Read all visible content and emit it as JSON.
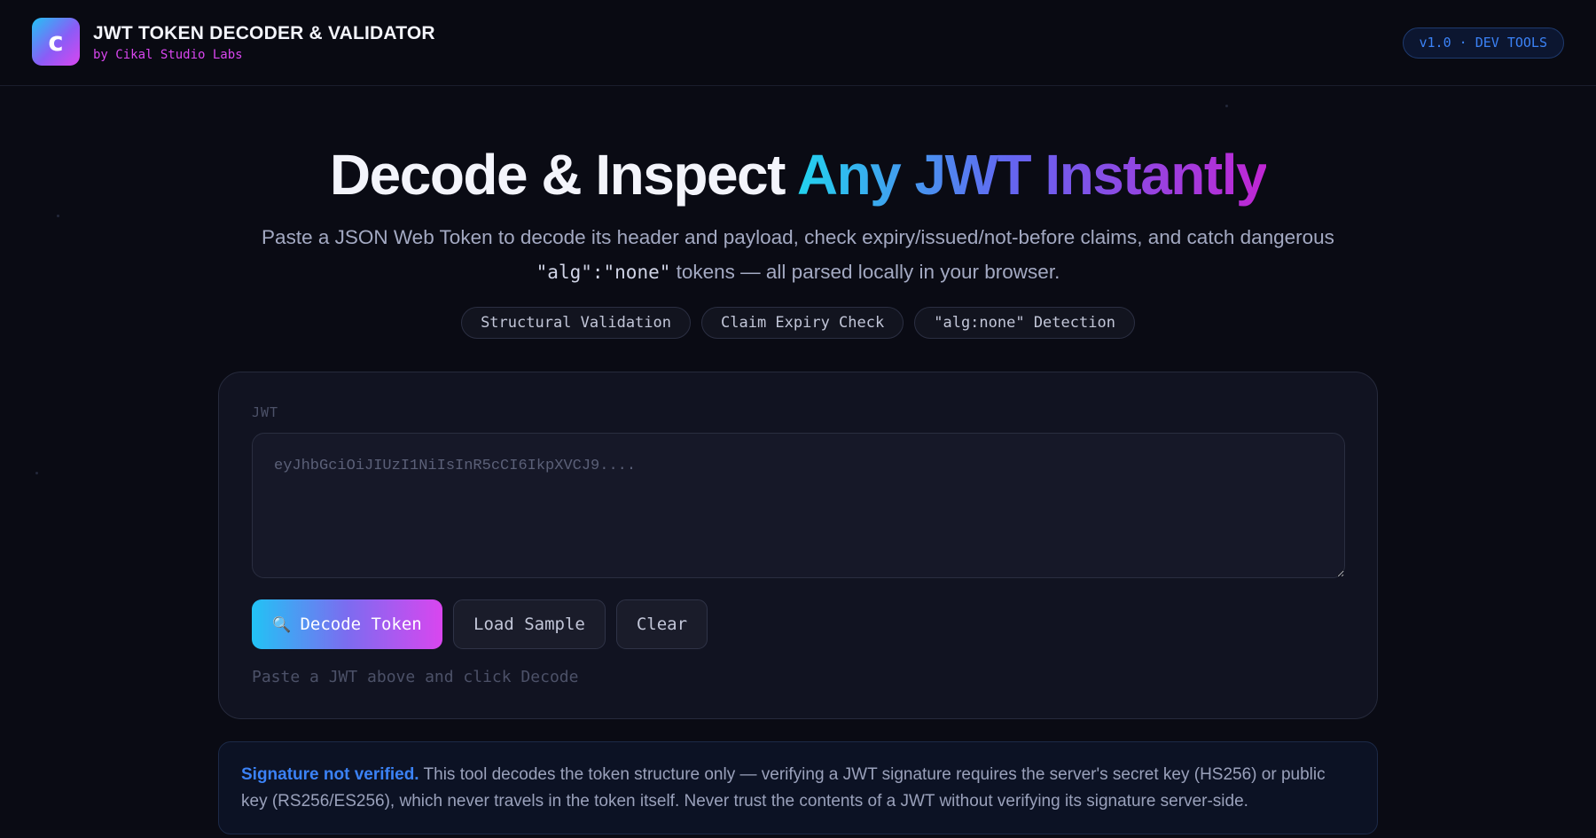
{
  "header": {
    "logo_letter": "c",
    "title": "JWT TOKEN DECODER & VALIDATOR",
    "subtitle": "by Cikal Studio Labs",
    "version_badge": "v1.0 · DEV TOOLS"
  },
  "hero": {
    "title_plain": "Decode & Inspect ",
    "title_accent": "Any JWT Instantly",
    "description_part1": "Paste a JSON Web Token to decode its header and payload, check expiry/issued/not-before claims, and catch dangerous ",
    "description_code": "\"alg\":\"none\"",
    "description_part2": " tokens — all parsed locally in your browser."
  },
  "feature_tags": [
    "Structural Validation",
    "Claim Expiry Check",
    "\"alg:none\" Detection"
  ],
  "decoder": {
    "field_label": "JWT",
    "input_value": "",
    "input_placeholder": "eyJhbGciOiJIUzI1NiIsInR5cCI6IkpXVCJ9....",
    "decode_button": "Decode Token",
    "decode_icon": "magnifier-icon",
    "load_sample_button": "Load Sample",
    "clear_button": "Clear",
    "status": "Paste a JWT above and click Decode"
  },
  "notice": {
    "strong": "Signature not verified.",
    "text": " This tool decodes the token structure only — verifying a JWT signature requires the server's secret key (HS256) or public key (RS256/ES256), which never travels in the token itself. Never trust the contents of a JWT without verifying its signature server-side."
  },
  "colors": {
    "background": "#0a0b14",
    "accent_cyan": "#22d3ee",
    "accent_violet": "#6366f1",
    "accent_magenta": "#d946ef",
    "notice_blue": "#3b82f6"
  }
}
